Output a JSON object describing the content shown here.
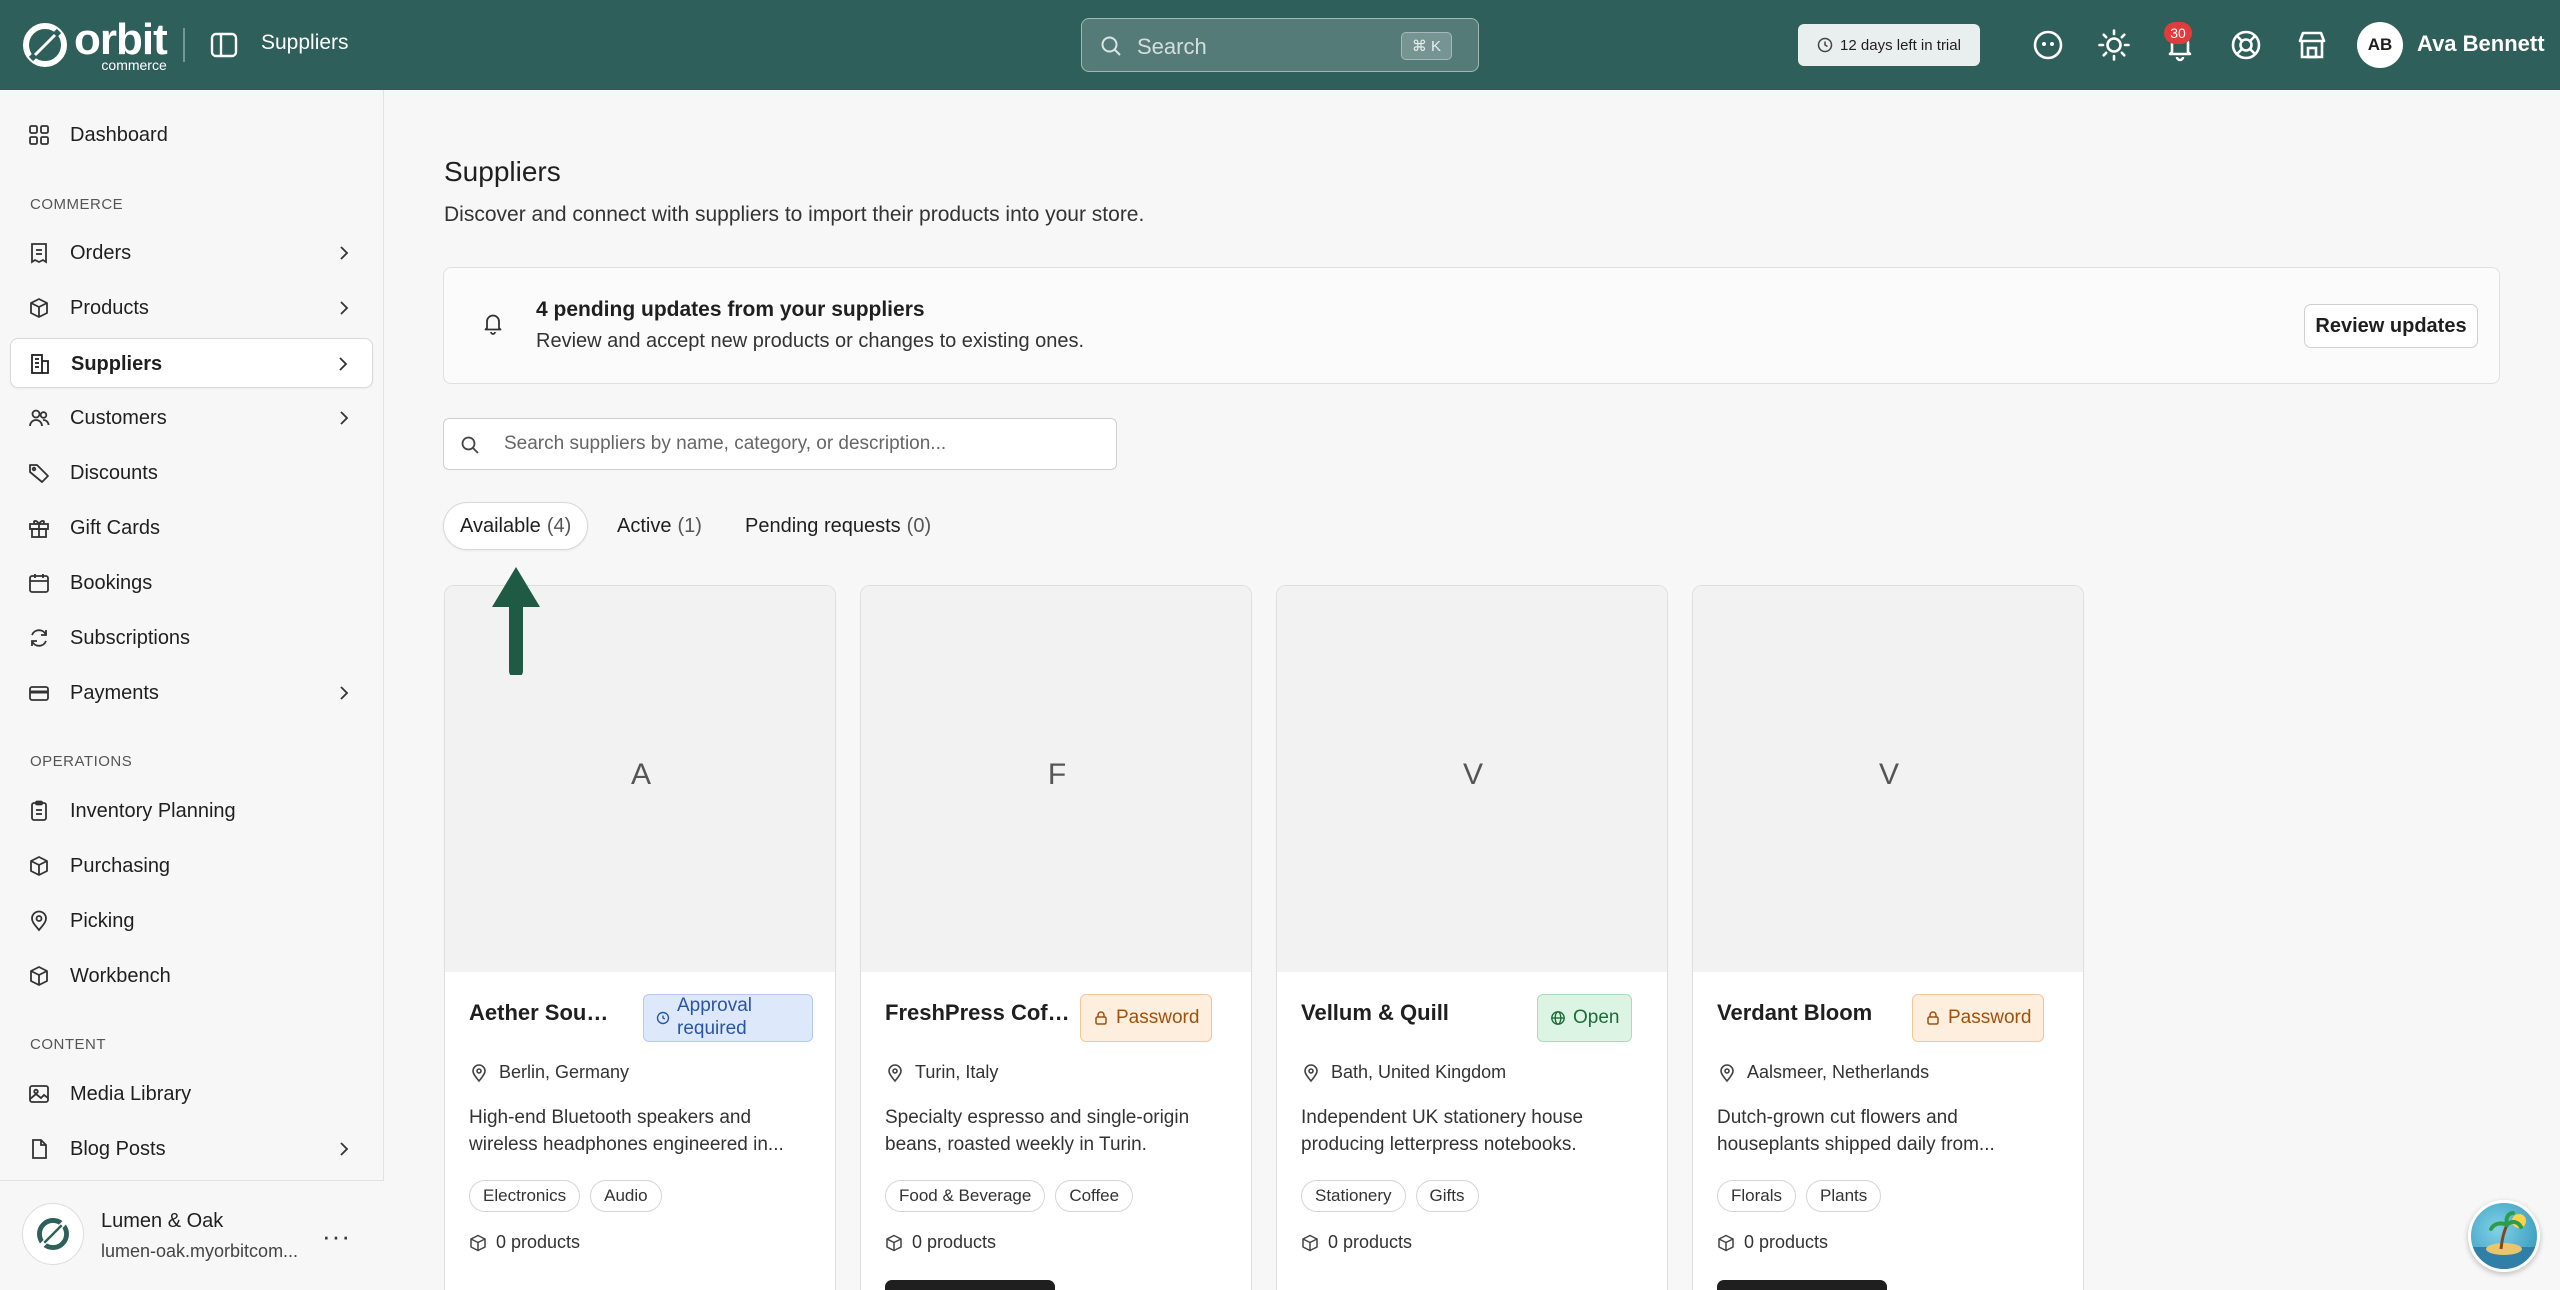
{
  "header": {
    "brand_name": "orbit",
    "brand_sub": "commerce",
    "page_label": "Suppliers",
    "search_placeholder": "Search",
    "search_shortcut": "⌘ K",
    "trial_text": "12 days left in trial",
    "notifications_count": "30",
    "user_initials": "AB",
    "user_name": "Ava Bennett"
  },
  "sidebar": {
    "dashboard": "Dashboard",
    "section_commerce": "COMMERCE",
    "commerce_items": [
      "Orders",
      "Products",
      "Suppliers",
      "Customers",
      "Discounts",
      "Gift Cards",
      "Bookings",
      "Subscriptions",
      "Payments"
    ],
    "section_operations": "OPERATIONS",
    "operations_items": [
      "Inventory Planning",
      "Purchasing",
      "Picking",
      "Workbench"
    ],
    "section_content": "CONTENT",
    "content_items": [
      "Media Library",
      "Blog Posts"
    ],
    "store_name": "Lumen & Oak",
    "store_url": "lumen-oak.myorbitcom..."
  },
  "main": {
    "title": "Suppliers",
    "subtitle": "Discover and connect with suppliers to import their products into your store.",
    "notice_title": "4 pending updates from your suppliers",
    "notice_text": "Review and accept new products or changes to existing ones.",
    "review_button": "Review updates",
    "supplier_search_placeholder": "Search suppliers by name, category, or description...",
    "tabs": [
      {
        "label": "Available",
        "count": "(4)"
      },
      {
        "label": "Active",
        "count": "(1)"
      },
      {
        "label": "Pending requests",
        "count": "(0)"
      }
    ]
  },
  "suppliers": [
    {
      "letter": "A",
      "name": "Aether Sound...",
      "status": "Approval required",
      "location": "Berlin, Germany",
      "description": "High-end Bluetooth speakers and wireless headphones engineered in...",
      "tags": [
        "Electronics",
        "Audio"
      ],
      "products": "0 products"
    },
    {
      "letter": "F",
      "name": "FreshPress Coffee",
      "status": "Password",
      "location": "Turin, Italy",
      "description": "Specialty espresso and single-origin beans, roasted weekly in Turin.",
      "tags": [
        "Food & Beverage",
        "Coffee"
      ],
      "products": "0 products"
    },
    {
      "letter": "V",
      "name": "Vellum & Quill",
      "status": "Open",
      "location": "Bath, United Kingdom",
      "description": "Independent UK stationery house producing letterpress notebooks.",
      "tags": [
        "Stationery",
        "Gifts"
      ],
      "products": "0 products"
    },
    {
      "letter": "V",
      "name": "Verdant Bloom",
      "status": "Password",
      "location": "Aalsmeer, Netherlands",
      "description": "Dutch-grown cut flowers and houseplants shipped daily from...",
      "tags": [
        "Florals",
        "Plants"
      ],
      "products": "0 products"
    }
  ],
  "colors": {
    "header_bg": "#2f5f5a",
    "arrow": "#1f5a44",
    "badge": "#e23b3b"
  }
}
